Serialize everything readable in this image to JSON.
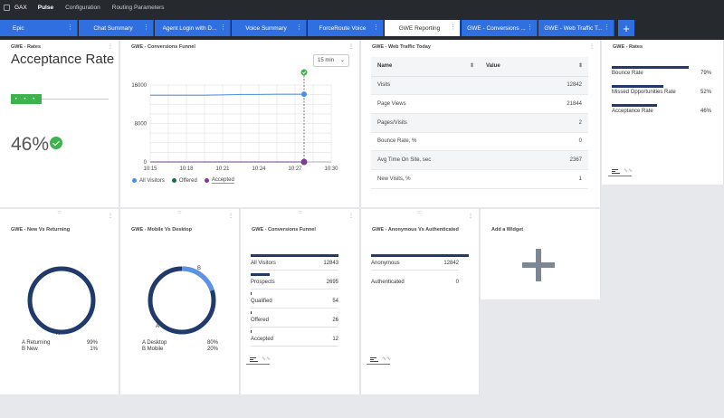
{
  "nav": {
    "logo": "GAX",
    "items": [
      {
        "label": "Pulse",
        "active": true
      },
      {
        "label": "Configuration",
        "active": false
      },
      {
        "label": "Routing Parameters",
        "active": false
      }
    ]
  },
  "tabs": [
    {
      "label": "Epic"
    },
    {
      "label": "Chat Summary"
    },
    {
      "label": "Agent Login with D..."
    },
    {
      "label": "Voice Summary"
    },
    {
      "label": "ForceRoute Voice"
    },
    {
      "label": "GWE Reporting",
      "active": true
    },
    {
      "label": "GWE - Conversions ..."
    },
    {
      "label": "GWE - Web Traffic T..."
    }
  ],
  "tab_add": "+",
  "w_rates1": {
    "title": "GWE - Rates",
    "metric": "Acceptance Rate",
    "dots": "• • •",
    "value": "46%"
  },
  "w_funnel": {
    "title": "GWE - Conversions Funnel",
    "interval": "15 min",
    "legend": [
      {
        "name": "All Visitors",
        "color": "#4a90e2"
      },
      {
        "name": "Offered",
        "color": "#1e6b4a"
      },
      {
        "name": "Accepted",
        "color": "#7a3e8c"
      }
    ]
  },
  "chart_data": {
    "type": "line",
    "x": [
      "10:15",
      "10:18",
      "10:21",
      "10:24",
      "10:27",
      "10:30"
    ],
    "y_ticks": [
      "16000",
      "8000",
      "0"
    ],
    "ylim": [
      0,
      16000
    ],
    "series": [
      {
        "name": "All Visitors",
        "color": "#4a90e2",
        "points": [
          [
            0,
            13900
          ],
          [
            0.5,
            13900
          ],
          [
            1,
            13900
          ],
          [
            1.5,
            13900
          ],
          [
            2,
            13950
          ],
          [
            2.5,
            14050
          ],
          [
            3,
            14050
          ],
          [
            3.5,
            14100
          ],
          [
            4,
            14100
          ],
          [
            4.25,
            14100
          ]
        ]
      },
      {
        "name": "Offered",
        "color": "#1e6b4a",
        "points": [
          [
            0,
            0
          ],
          [
            4.25,
            0
          ]
        ]
      },
      {
        "name": "Accepted",
        "color": "#7a3e8c",
        "points": [
          [
            0,
            0
          ],
          [
            4.25,
            0
          ]
        ]
      }
    ]
  },
  "w_web": {
    "title": "GWE - Web Traffic Today",
    "col_name": "Name",
    "col_value": "Value",
    "rows": [
      {
        "name": "Visits",
        "value": "12842"
      },
      {
        "name": "Page Views",
        "value": "21844"
      },
      {
        "name": "Pages/Visits",
        "value": "2"
      },
      {
        "name": "Bounce Rate, %",
        "value": "0"
      },
      {
        "name": "Avg Time On Site, sec",
        "value": "2367"
      },
      {
        "name": "New Visits, %",
        "value": "1"
      }
    ]
  },
  "w_rates2": {
    "title": "GWE - Rates",
    "rows": [
      {
        "label": "Bounce Rate",
        "value": "79%",
        "fraction": 0.79
      },
      {
        "label": "Missed Opportunities Rate",
        "value": "52%",
        "fraction": 0.52
      },
      {
        "label": "Acceptance Rate",
        "value": "46%",
        "fraction": 0.46
      }
    ]
  },
  "w_newret": {
    "title": "GWE - New Vs Returning",
    "marker": "A",
    "legend": [
      {
        "label": "A Returning",
        "value": "99%"
      },
      {
        "label": "B New",
        "value": "1%"
      }
    ]
  },
  "w_mobile": {
    "title": "GWE - Mobile Vs Desktop",
    "marker_a": "A",
    "marker_b": "B",
    "legend": [
      {
        "label": "A Desktop",
        "value": "80%"
      },
      {
        "label": "B Mobile",
        "value": "20%"
      }
    ]
  },
  "w_funnel2": {
    "title": "GWE - Conversions Funnel",
    "rows": [
      {
        "label": "All Visitors",
        "value": "12843",
        "fraction": 1.0
      },
      {
        "label": "Prospects",
        "value": "2695",
        "fraction": 0.21
      },
      {
        "label": "Qualified",
        "value": "54",
        "fraction": 0.004
      },
      {
        "label": "Offered",
        "value": "26",
        "fraction": 0.002
      },
      {
        "label": "Accepted",
        "value": "12",
        "fraction": 0.001
      }
    ]
  },
  "w_anon": {
    "title": "GWE - Anonymous Vs Authenticated",
    "rows": [
      {
        "label": "Anonymous",
        "value": "12842",
        "fraction": 1.0
      },
      {
        "label": "Authenticated",
        "value": "0",
        "fraction": 0
      }
    ]
  },
  "w_add": {
    "title": "Add a Widget"
  },
  "icons": {
    "kebab": "⋮",
    "drag": ":::",
    "sort": "⇕",
    "chevron": "⌄",
    "wave": "∿∿"
  }
}
